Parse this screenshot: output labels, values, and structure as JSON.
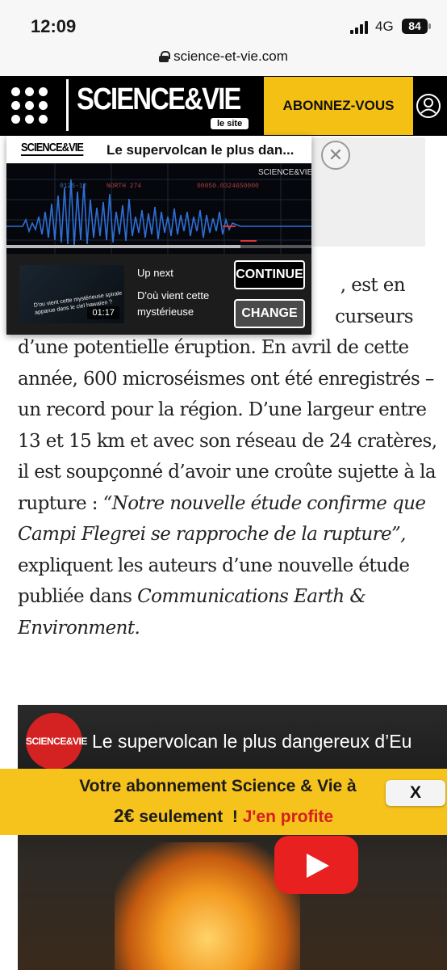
{
  "status_bar": {
    "time": "12:09",
    "network": "4G",
    "battery": "84"
  },
  "browser": {
    "url": "science-et-vie.com"
  },
  "header": {
    "brand": "SCIENCE&VIE",
    "brand_tag": "le site",
    "subscribe_label": "ABONNEZ-VOUS"
  },
  "player": {
    "logo": "SCIENCE&VIE",
    "title": "Le supervolcan le plus dan...",
    "watermark": "SCIENCE&VIE",
    "overlay_texts": [
      "0125-12",
      "NORTH 274",
      "00050.0324650000"
    ],
    "up_next_label": "Up next",
    "up_next_title": "D'où vient cette mystérieuse",
    "thumb_caption": "D'ou vient cette mystérieuse spirale apparue dans le ciel hawaïen ?",
    "thumb_duration": "01:17",
    "continue_label": "CONTINUE",
    "change_label": "CHANGE"
  },
  "article": {
    "lines_visible": [
      ", est en",
      "curseurs"
    ],
    "p1_tail": "d’une potentielle éruption. En avril de cette année, 600 microséismes ont été enregistrés – un record pour la région. D’une largeur entre 13 et 15 km et avec son réseau de 24 cratères, il est soupçonné d’avoir une croûte sujette à la rupture :",
    "quote": "“Notre nouvelle étude confirme que Campi Flegrei se rapproche de la rupture”,",
    "p2": "expliquent les auteurs d’une nouvelle étude publiée dans",
    "journal": "Communications Earth & Environment."
  },
  "video_embed": {
    "channel": "SCIENCE&VIE",
    "title": "Le supervolcan le plus dangereux d’Eu"
  },
  "promo": {
    "line1": "Votre abonnement Science & Vie à",
    "price": "2€",
    "price_suffix": "seulement",
    "excl": "!",
    "cta": "J'en profite",
    "close_label": "X"
  },
  "colors": {
    "accent_yellow": "#f5c014",
    "header_bg": "#000000",
    "cta_red": "#d41f1f",
    "youtube_red": "#e8201f"
  }
}
